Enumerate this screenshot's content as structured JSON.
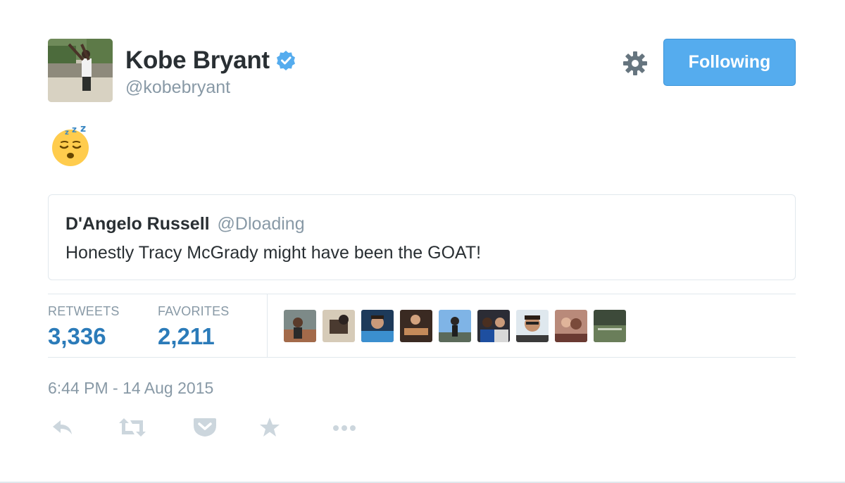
{
  "author": {
    "name": "Kobe Bryant",
    "username": "@kobebryant",
    "verified_icon": "verified-badge-icon"
  },
  "header": {
    "settings_icon": "gear-icon",
    "follow_label": "Following"
  },
  "tweet": {
    "emoji_icon": "sleeping-face-emoji"
  },
  "quote": {
    "name": "D'Angelo Russell",
    "username": "@Dloading",
    "text": "Honestly Tracy McGrady might have been the GOAT!"
  },
  "stats": {
    "retweets_label": "RETWEETS",
    "retweets_value": "3,336",
    "favorites_label": "FAVORITES",
    "favorites_value": "2,211"
  },
  "timestamp": "6:44 PM - 14 Aug 2015",
  "actions": [
    "reply-icon",
    "retweet-icon",
    "pocket-icon",
    "favorite-star-icon",
    "more-icon"
  ],
  "colors": {
    "accent": "#55acee",
    "stat_value": "#2b7bb9",
    "muted": "#8899a6",
    "border": "#e1e8ed",
    "text": "#292f33"
  }
}
